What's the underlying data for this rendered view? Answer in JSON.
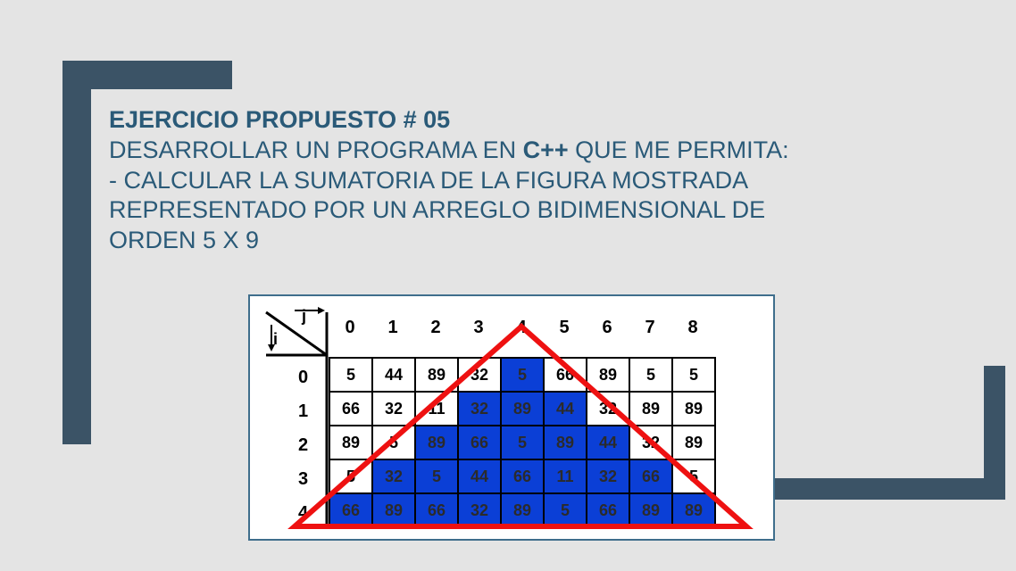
{
  "title": "EJERCICIO PROPUESTO # 05",
  "line1_a": "DESARROLLAR   UN  PROGRAMA EN ",
  "cpp": "C++",
  "line1_b": "  QUE ME PERMITA:",
  "line2": "- CALCULAR  LA SUMATORIA DE  LA FIGURA MOSTRADA",
  "line3": "REPRESENTADO  POR  UN ARREGLO BIDIMENSIONAL  DE",
  "line4": "ORDEN  5 X 9",
  "j_label": "j",
  "i_label": "i",
  "cols": [
    "0",
    "1",
    "2",
    "3",
    "4",
    "5",
    "6",
    "7",
    "8"
  ],
  "rows": [
    "0",
    "1",
    "2",
    "3",
    "4"
  ],
  "matrix": [
    [
      {
        "v": "5",
        "h": 0
      },
      {
        "v": "44",
        "h": 0
      },
      {
        "v": "89",
        "h": 0
      },
      {
        "v": "32",
        "h": 0
      },
      {
        "v": "5",
        "h": 1
      },
      {
        "v": "66",
        "h": 0
      },
      {
        "v": "89",
        "h": 0
      },
      {
        "v": "5",
        "h": 0
      },
      {
        "v": "5",
        "h": 0
      }
    ],
    [
      {
        "v": "66",
        "h": 0
      },
      {
        "v": "32",
        "h": 0
      },
      {
        "v": "11",
        "h": 0
      },
      {
        "v": "32",
        "h": 1
      },
      {
        "v": "89",
        "h": 1
      },
      {
        "v": "44",
        "h": 1
      },
      {
        "v": "32",
        "h": 0
      },
      {
        "v": "89",
        "h": 0
      },
      {
        "v": "89",
        "h": 0
      }
    ],
    [
      {
        "v": "89",
        "h": 0
      },
      {
        "v": "5",
        "h": 0
      },
      {
        "v": "89",
        "h": 1
      },
      {
        "v": "66",
        "h": 1
      },
      {
        "v": "5",
        "h": 1
      },
      {
        "v": "89",
        "h": 1
      },
      {
        "v": "44",
        "h": 1
      },
      {
        "v": "32",
        "h": 0
      },
      {
        "v": "89",
        "h": 0
      }
    ],
    [
      {
        "v": "5",
        "h": 0
      },
      {
        "v": "32",
        "h": 1
      },
      {
        "v": "5",
        "h": 1
      },
      {
        "v": "44",
        "h": 1
      },
      {
        "v": "66",
        "h": 1
      },
      {
        "v": "11",
        "h": 1
      },
      {
        "v": "32",
        "h": 1
      },
      {
        "v": "66",
        "h": 1
      },
      {
        "v": "5",
        "h": 0
      }
    ],
    [
      {
        "v": "66",
        "h": 1
      },
      {
        "v": "89",
        "h": 1
      },
      {
        "v": "66",
        "h": 1
      },
      {
        "v": "32",
        "h": 1
      },
      {
        "v": "89",
        "h": 1
      },
      {
        "v": "5",
        "h": 1
      },
      {
        "v": "66",
        "h": 1
      },
      {
        "v": "89",
        "h": 1
      },
      {
        "v": "89",
        "h": 1
      }
    ]
  ]
}
